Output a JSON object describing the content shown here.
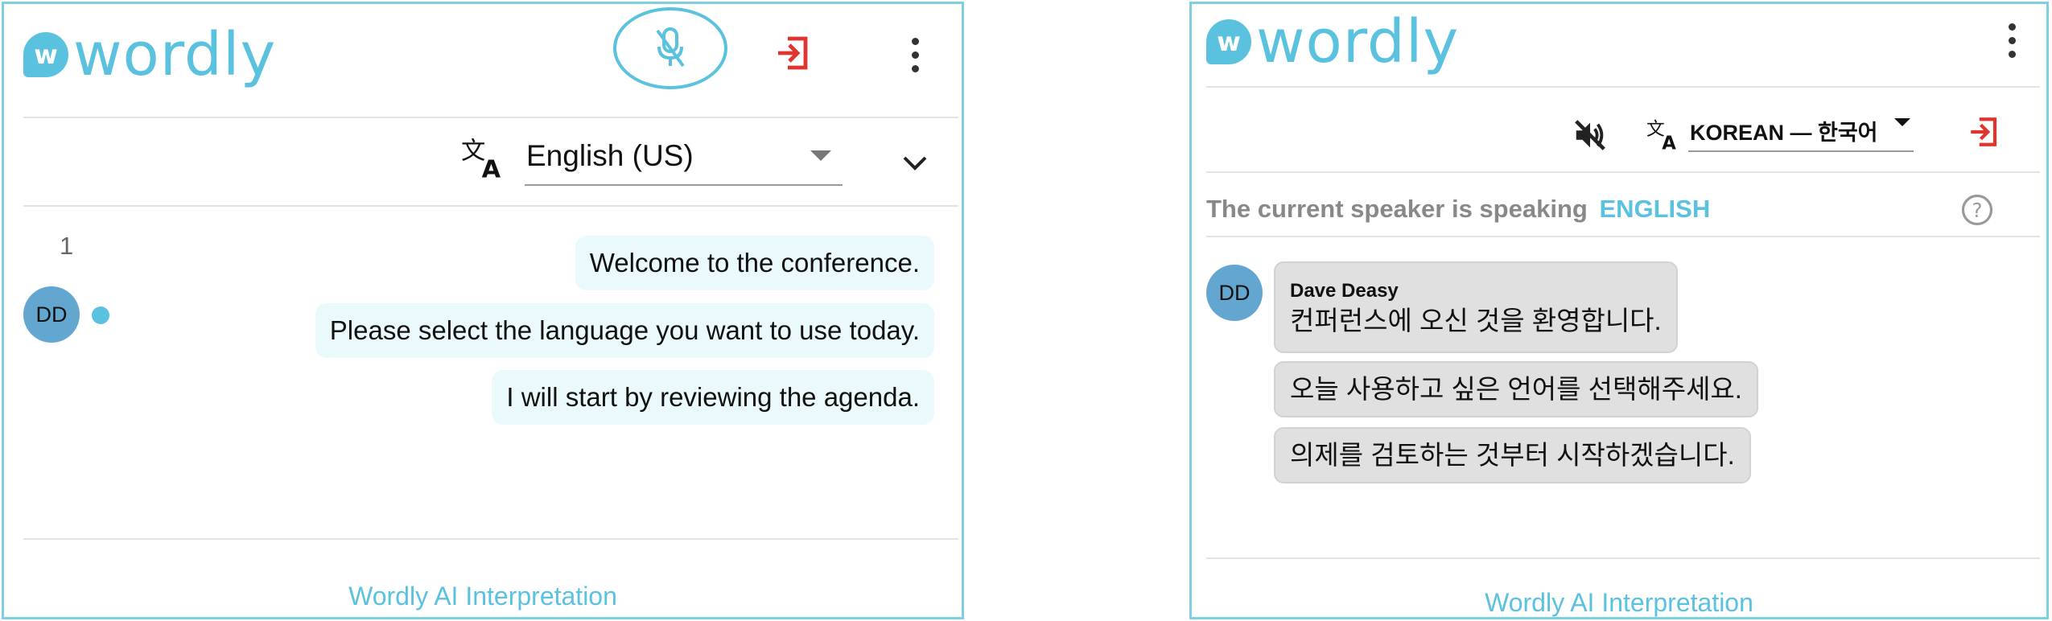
{
  "left": {
    "logo_letter": "w",
    "logo_text": "wordly",
    "language_select": "English (US)",
    "message_count": "1",
    "speaker_initials": "DD",
    "messages": [
      "Welcome to the conference.",
      "Please select the language you want to use today.",
      "I will start by reviewing the agenda."
    ],
    "footer": "Wordly AI Interpretation"
  },
  "right": {
    "logo_letter": "w",
    "logo_text": "wordly",
    "language_select": "KOREAN — 한국어",
    "speaker_status_prefix": "The current speaker is speaking",
    "speaker_language": "ENGLISH",
    "speaker_initials": "DD",
    "speaker_name": "Dave Deasy",
    "messages": [
      "컨퍼런스에 오신 것을 환영합니다.",
      "오늘 사용하고 싶은 언어를 선택해주세요.",
      "의제를 검토하는 것부터 시작하겠습니다."
    ],
    "footer": "Wordly AI Interpretation"
  },
  "colors": {
    "brand": "#5ac1de",
    "exit": "#e0342f",
    "bubble_left": "#e9f9fc",
    "bubble_right": "#e0e0e0",
    "avatar": "#63a7d1"
  },
  "icons": {
    "mic": "mic-muted-icon",
    "exit": "exit-icon",
    "menu": "kebab-menu-icon",
    "translate": "translate-icon",
    "dropdown": "caret-down-icon",
    "collapse": "chevron-down-icon",
    "volume": "volume-muted-icon",
    "help": "help-icon"
  }
}
